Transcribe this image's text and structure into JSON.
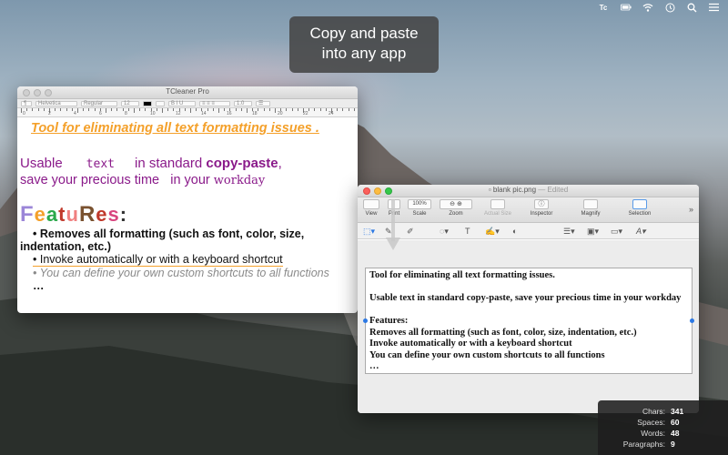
{
  "menubar": {
    "icons": [
      "tc-logo-icon",
      "battery-icon",
      "wifi-icon",
      "clock-icon",
      "search-icon",
      "list-icon"
    ],
    "tc_logo_text": "Tc"
  },
  "tooltip": {
    "line1": "Copy and paste",
    "line2": "into any app"
  },
  "textcleaner": {
    "title": "TCleaner Pro",
    "toolbar": {
      "font": "Helvetica",
      "style": "Regular",
      "size": "12",
      "spacing": "1.0"
    },
    "ruler_numbers": [
      "0",
      "2",
      "4",
      "6",
      "8",
      "10",
      "12",
      "14",
      "16",
      "18",
      "20",
      "22",
      "24"
    ],
    "line1": "Tool for eliminating all text formatting issues .",
    "usable": {
      "a": "Usable",
      "b": "text",
      "c": "in standard",
      "d": "copy-paste",
      "e": ","
    },
    "save": {
      "a": "save your precious time",
      "b": "in your",
      "c": "workday"
    },
    "features": [
      "F",
      "e",
      "a",
      "t",
      "u",
      "R",
      "e",
      "s",
      ":"
    ],
    "items": [
      "• Removes all formatting (such as font, color, size,",
      "indentation, etc.)",
      "• Invoke automatically or with a keyboard shortcut",
      "• You can define your own custom shortcuts to all functions",
      "…"
    ]
  },
  "preview": {
    "title": "blank pic.png",
    "edited": "— Edited",
    "toolbar": {
      "view": "View",
      "print": "Print",
      "scale": "Scale",
      "scale_value": "100%",
      "zoom": "Zoom",
      "actual_size": "Actual Size",
      "inspector": "Inspector",
      "magnify": "Magnify",
      "selection": "Selection"
    },
    "lines": [
      "Tool for eliminating all text formatting issues.",
      "",
      "Usable text in standard copy-paste, save your precious time in your workday",
      "",
      "Features:",
      "Removes all formatting (such as font, color, size, indentation, etc.)",
      "Invoke automatically or with a keyboard shortcut",
      "You can define your own custom shortcuts to all functions",
      "…"
    ]
  },
  "stats": [
    {
      "label": "Chars:",
      "value": "341"
    },
    {
      "label": "Spaces:",
      "value": "60"
    },
    {
      "label": "Words:",
      "value": "48"
    },
    {
      "label": "Paragraphs:",
      "value": "9"
    }
  ],
  "colors": {
    "orange": "#f4a02a",
    "purple": "#8a1a8a",
    "blue_handle": "#2b78e4",
    "feature_letters": [
      "#9b86d8",
      "#f4a02a",
      "#2aa84a",
      "#c0392b",
      "#f08080",
      "#7a5230",
      "#c0392b",
      "#d8457f",
      "#333333"
    ]
  }
}
